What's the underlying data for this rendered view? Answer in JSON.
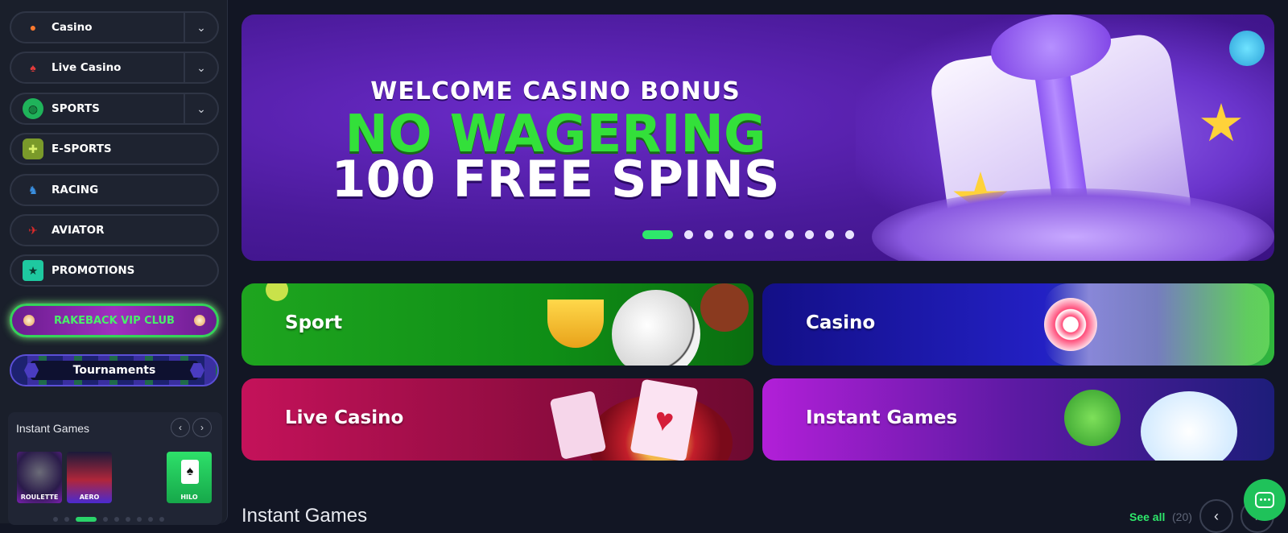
{
  "sidebar": {
    "items": [
      {
        "label": "Casino",
        "icon": "cherry-icon",
        "has_dropdown": true
      },
      {
        "label": "Live Casino",
        "icon": "spade-icon",
        "has_dropdown": true
      },
      {
        "label": "SPORTS",
        "icon": "basketball-icon",
        "has_dropdown": true
      },
      {
        "label": "E-SPORTS",
        "icon": "gamepad-icon",
        "has_dropdown": false
      },
      {
        "label": "RACING",
        "icon": "horse-icon",
        "has_dropdown": false
      },
      {
        "label": "AVIATOR",
        "icon": "airplane-icon",
        "has_dropdown": false
      },
      {
        "label": "PROMOTIONS",
        "icon": "ribbon-icon",
        "has_dropdown": false
      }
    ],
    "vip_label": "RAKEBACK VIP CLUB",
    "tournaments_label": "Tournaments",
    "instant_games": {
      "title": "Instant Games",
      "thumbs": [
        {
          "label": "ROULETTE"
        },
        {
          "label": "AERO"
        },
        {
          "label": "HILO"
        }
      ],
      "active_dot": 2,
      "dot_count": 10
    }
  },
  "banner": {
    "line1": "WELCOME CASINO BONUS",
    "line2": "NO WAGERING",
    "line3": "100 FREE SPINS",
    "slide_count": 11,
    "active_slide": 0
  },
  "tiles": {
    "sport": "Sport",
    "casino": "Casino",
    "live_casino": "Live Casino",
    "instant_games": "Instant Games"
  },
  "section": {
    "title": "Instant Games",
    "see_all": "See all",
    "count": "(20)"
  },
  "colors": {
    "accent": "#2ee86b",
    "background": "#121624",
    "sidebar": "#1a1f2b"
  }
}
